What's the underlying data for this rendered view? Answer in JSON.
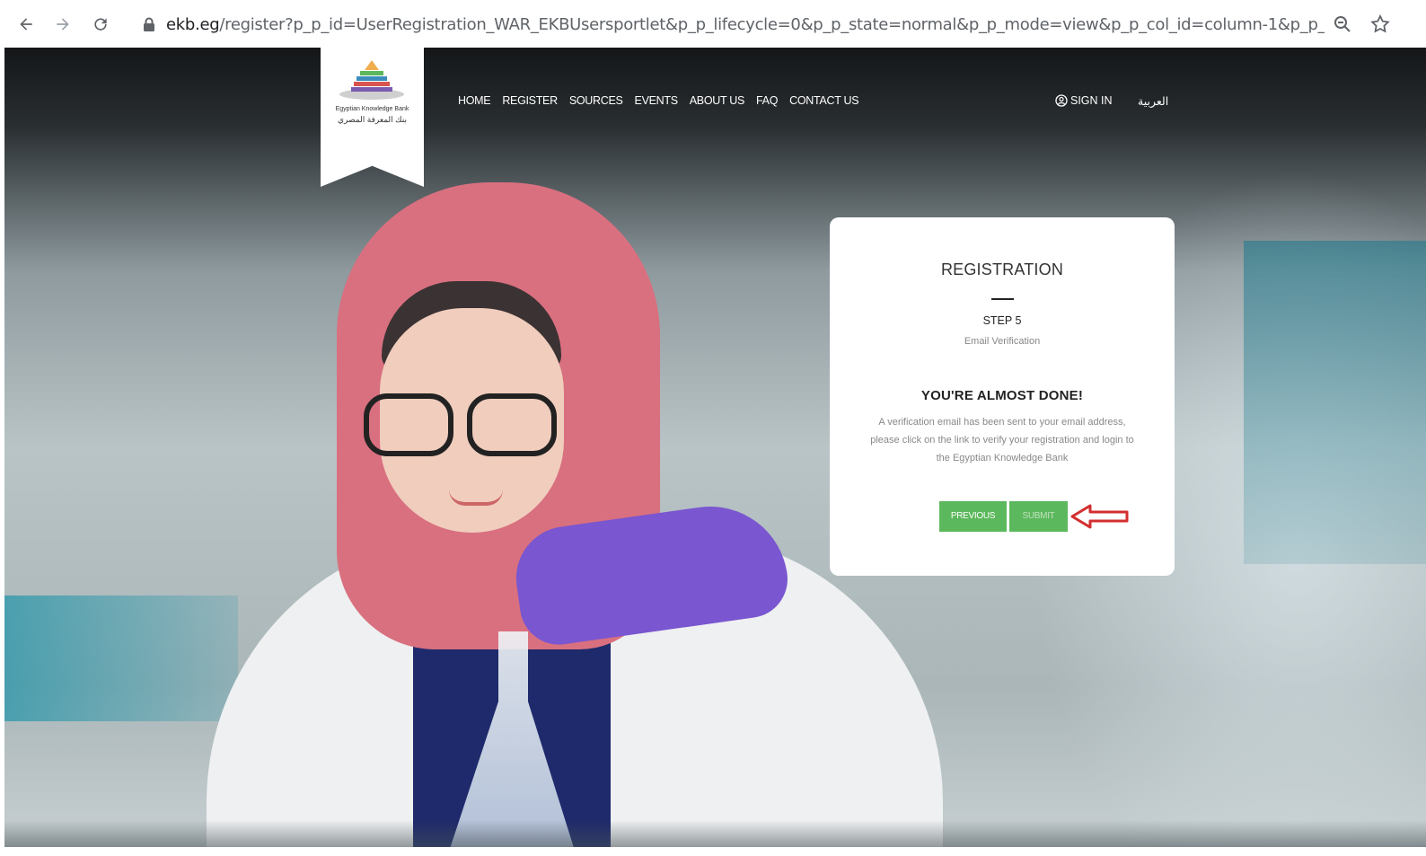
{
  "browser": {
    "url_host": "ekb.eg",
    "url_path": "/register?p_p_id=UserRegistration_WAR_EKBUsersportlet&p_p_lifecycle=0&p_p_state=normal&p_p_mode=view&p_p_col_id=column-1&p_p_col_count..."
  },
  "site": {
    "logo_text_en": "Egyptian Knowledge Bank",
    "logo_text_ar": "بنك المعرفة المصري",
    "nav": [
      "HOME",
      "REGISTER",
      "SOURCES",
      "EVENTS",
      "ABOUT US",
      "FAQ",
      "CONTACT US"
    ],
    "sign_in": "SIGN IN",
    "language": "العربية"
  },
  "registration": {
    "title": "REGISTRATION",
    "step": "STEP 5",
    "step_label": "Email Verification",
    "heading": "YOU'RE ALMOST DONE!",
    "message": "A verification email has been sent to your email address, please click on the link to verify your registration and login to the Egyptian Knowledge Bank",
    "previous_label": "PREVIOUS",
    "submit_label": "SUBMIT"
  },
  "colors": {
    "button_green": "#5cb85c",
    "annotation_arrow": "#d32f2f"
  }
}
